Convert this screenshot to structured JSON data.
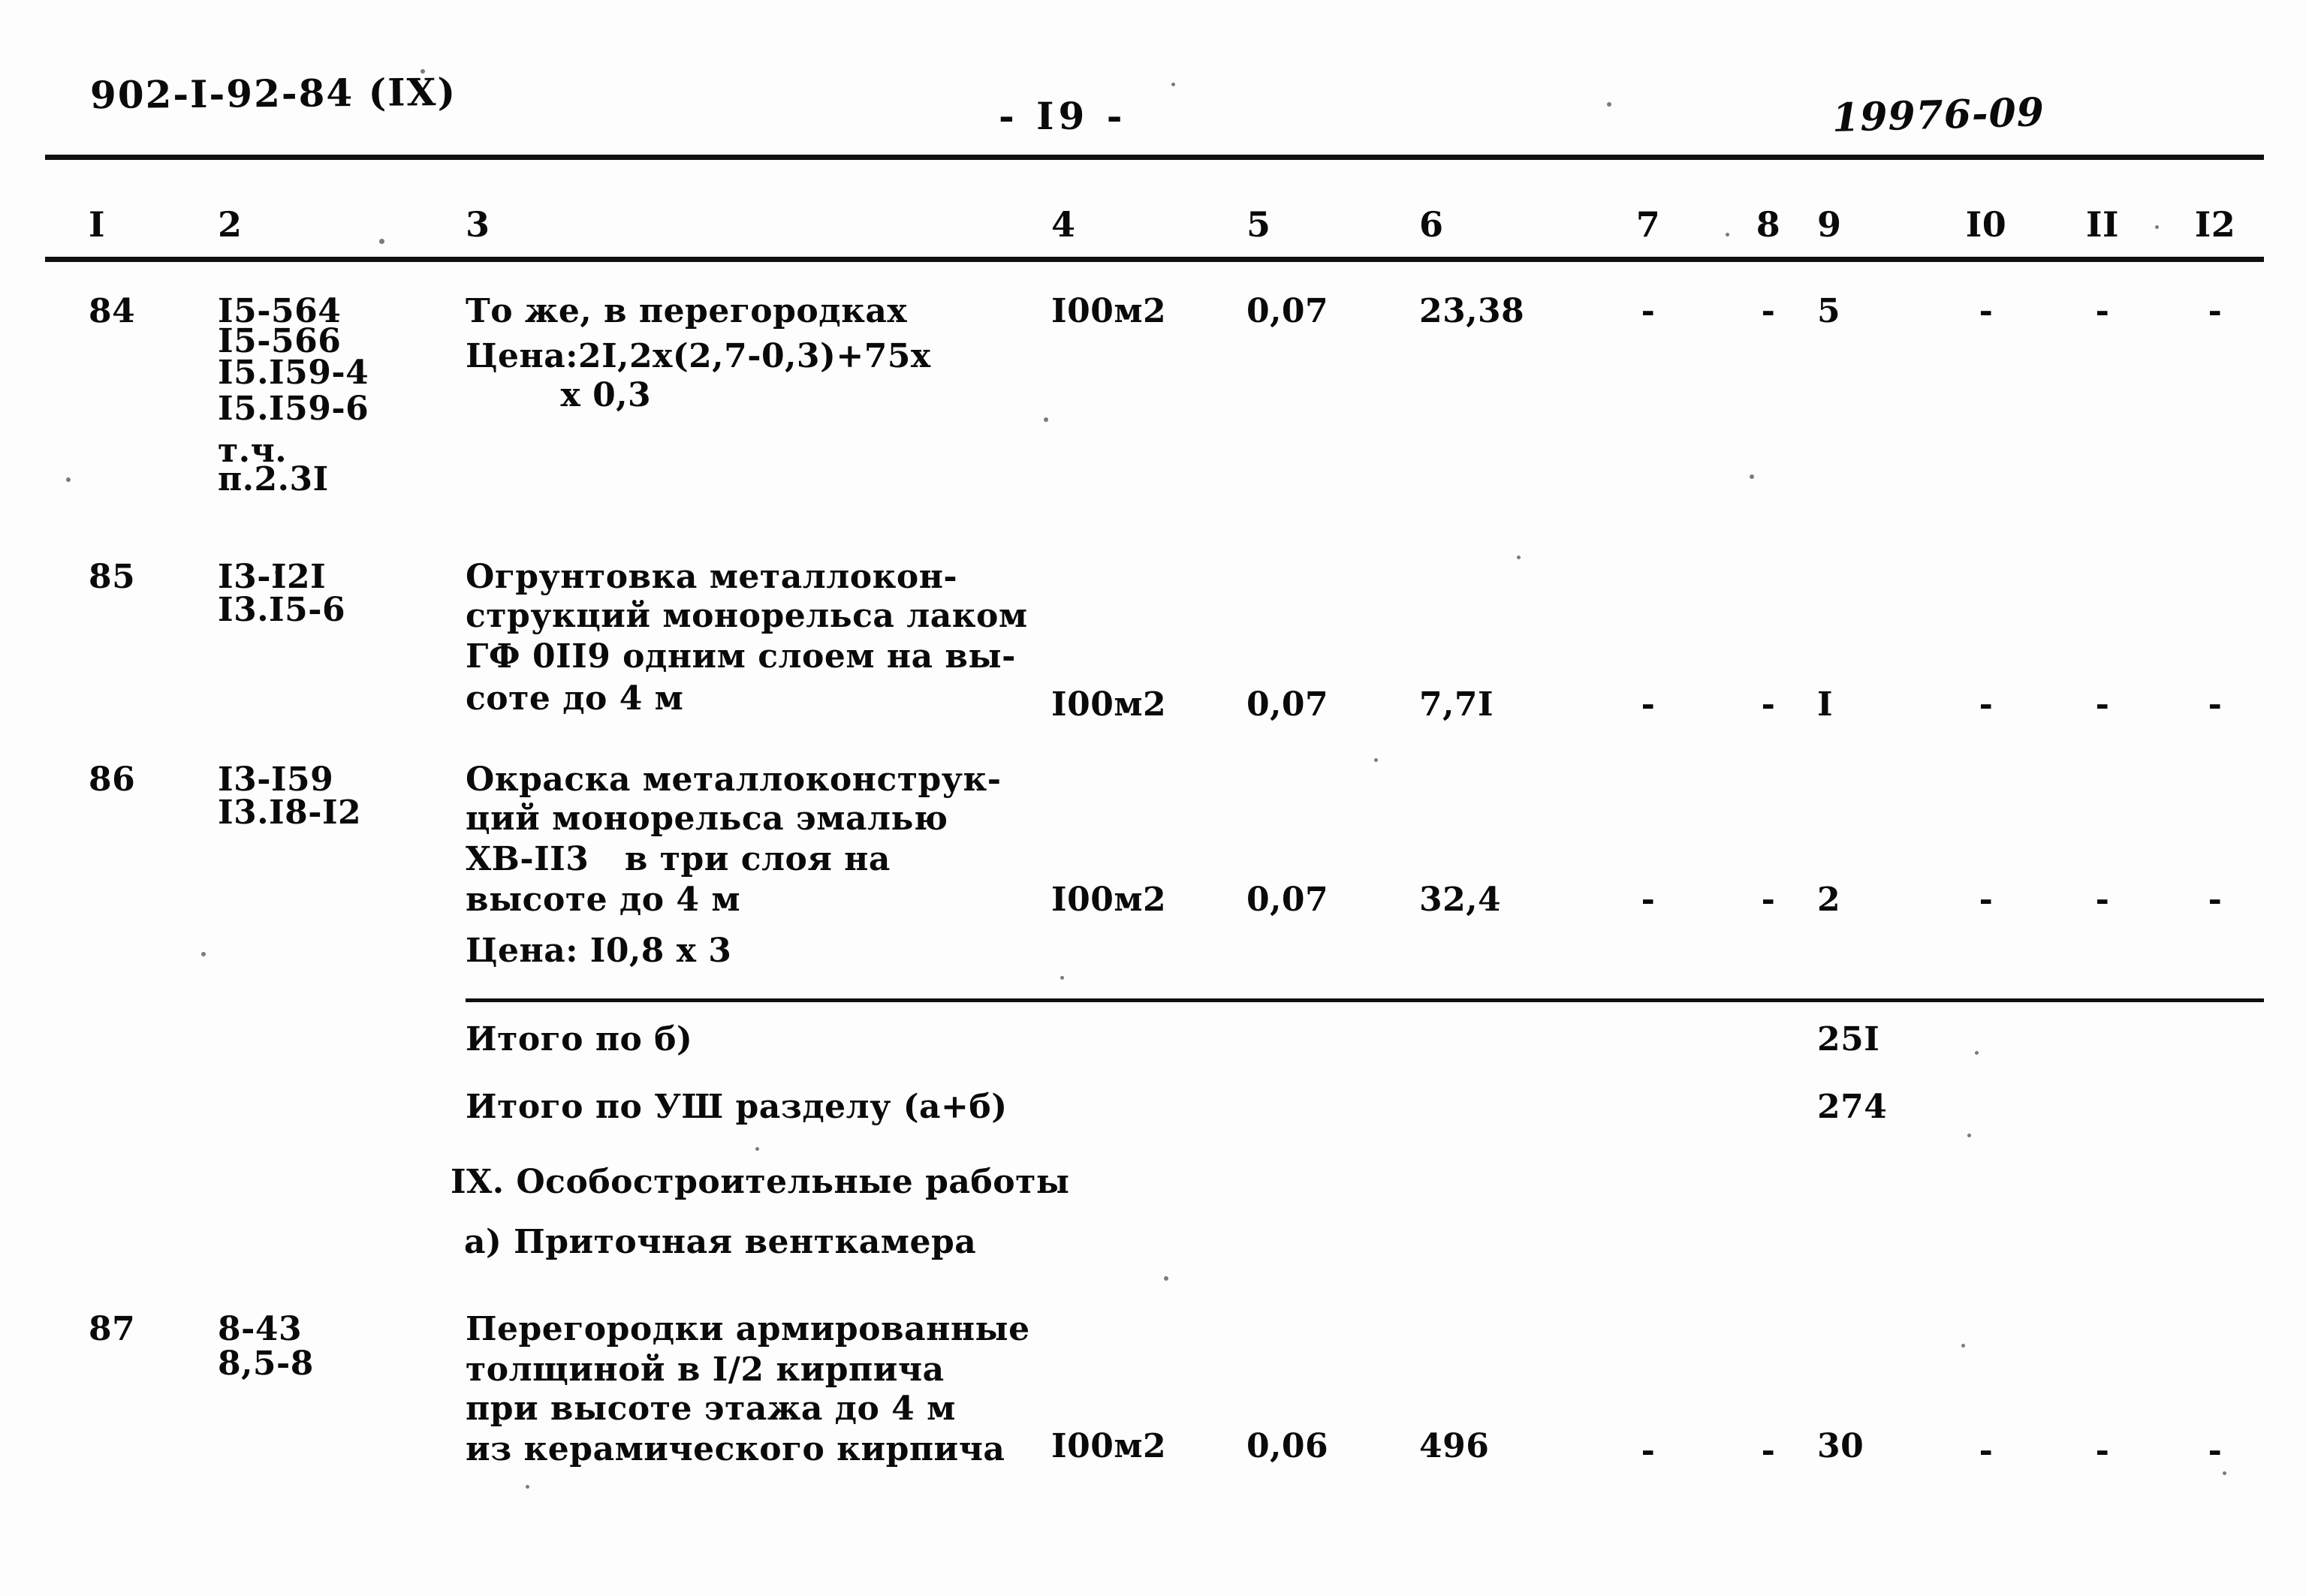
{
  "header": {
    "document_code": "902-I-92-84  (IX)",
    "page_number": "- I9 -",
    "archive_stamp": "19976-09"
  },
  "table": {
    "column_headers": [
      "I",
      "2",
      "3",
      "4",
      "5",
      "6",
      "7",
      "8",
      "9",
      "I0",
      "II",
      "I2"
    ],
    "rows": [
      {
        "num": "84",
        "codes": [
          "I5-564",
          "I5-566",
          "I5.I59-4",
          "I5.I59-6",
          "т.ч.",
          "п.2.3I"
        ],
        "desc": [
          "То же, в перегородках",
          "Цена:2I,2х(2,7-0,3)+75х",
          "        х 0,3"
        ],
        "unit": "I00м2",
        "c5": "0,07",
        "c6": "23,38",
        "c7": "-",
        "c8": "-",
        "c9": "5",
        "c10": "-",
        "c11": "-",
        "c12": "-"
      },
      {
        "num": "85",
        "codes": [
          "I3-I2I",
          "I3.I5-6"
        ],
        "desc": [
          "Огрунтовка металлокон-",
          "струкций монорельса лаком",
          "ГФ 0II9 одним слоем на вы-",
          "соте до 4 м"
        ],
        "unit": "I00м2",
        "c5": "0,07",
        "c6": "7,7I",
        "c7": "-",
        "c8": "-",
        "c9": "I",
        "c10": "-",
        "c11": "-",
        "c12": "-"
      },
      {
        "num": "86",
        "codes": [
          "I3-I59",
          "I3.I8-I2"
        ],
        "desc": [
          "Окраска металлоконструк-",
          "ций монорельса эмалью",
          "ХВ-II3   в три слоя на",
          "высоте до 4 м",
          "Цена: I0,8 х 3"
        ],
        "unit": "I00м2",
        "c5": "0,07",
        "c6": "32,4",
        "c7": "-",
        "c8": "-",
        "c9": "2",
        "c10": "-",
        "c11": "-",
        "c12": "-"
      },
      {
        "num": "87",
        "codes": [
          "8-43",
          "8,5-8"
        ],
        "desc": [
          "Перегородки армированные",
          "толщиной в I/2 кирпича",
          "при высоте этажа до 4 м",
          "из керамического кирпича"
        ],
        "unit": "I00м2",
        "c5": "0,06",
        "c6": "496",
        "c7": "-",
        "c8": "-",
        "c9": "30",
        "c10": "-",
        "c11": "-",
        "c12": "-"
      }
    ],
    "totals": [
      {
        "label": "Итого по б)",
        "value": "25I"
      },
      {
        "label": "Итого по УШ разделу (а+б)",
        "value": "274"
      }
    ],
    "section_headings": [
      "IX. Особостроительные работы",
      "а) Приточная венткамера"
    ]
  }
}
